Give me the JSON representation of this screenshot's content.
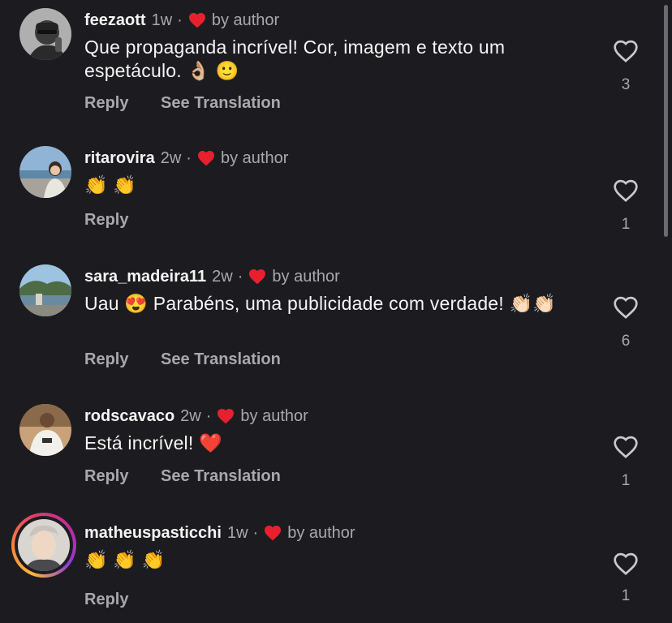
{
  "comments": [
    {
      "username": "feezaott",
      "time": "1w",
      "separator": "·",
      "by_author": "by author",
      "text": "Que propaganda incrível! Cor, imagem e texto um espetáculo. 👌🏼 🙂",
      "reply": "Reply",
      "translate": "See Translation",
      "likes": "3"
    },
    {
      "username": "ritarovira",
      "time": "2w",
      "separator": "·",
      "by_author": "by author",
      "text": "👏 👏",
      "reply": "Reply",
      "likes": "1"
    },
    {
      "username": "sara_madeira11",
      "time": "2w",
      "separator": "·",
      "by_author": "by author",
      "text": "Uau 😍 Parabéns, uma publicidade com verdade! 👏🏻👏🏻",
      "reply": "Reply",
      "translate": "See Translation",
      "likes": "6"
    },
    {
      "username": "rodscavaco",
      "time": "2w",
      "separator": "·",
      "by_author": "by author",
      "text": "Está incrível! ❤️",
      "reply": "Reply",
      "translate": "See Translation",
      "likes": "1"
    },
    {
      "username": "matheuspasticchi",
      "time": "1w",
      "separator": "·",
      "by_author": "by author",
      "text": "👏 👏 👏",
      "reply": "Reply",
      "likes": "1"
    }
  ],
  "colors": {
    "background": "#1c1c20",
    "muted": "#a8a8ad",
    "author_heart": "#e8202e"
  },
  "icons": {
    "like": "heart-outline-icon",
    "author_like": "heart-filled-icon"
  }
}
